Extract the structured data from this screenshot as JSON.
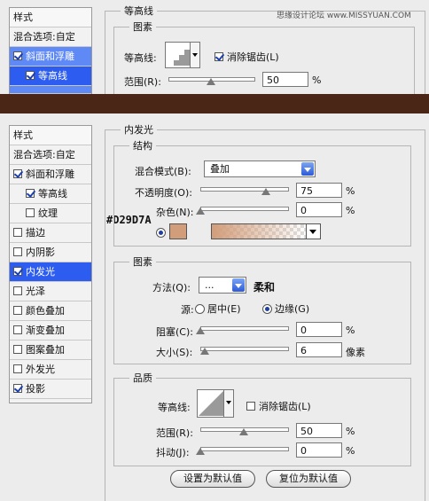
{
  "watermark": "思缘设计论坛 www.MISSYUAN.COM",
  "colors": {
    "swatch": "#D29D7A",
    "selected_row": "#2d5df0",
    "band": "#4a2616"
  },
  "color_annotation": "#D29D7A",
  "top_panel": {
    "sidebar": {
      "header": "样式",
      "blend_options": "混合选项:自定",
      "bevel": "斜面和浮雕",
      "contour": "等高线",
      "texture": "纹理"
    },
    "section_title": "等高线",
    "group_title": "图素",
    "contour_label": "等高线:",
    "antialias_label": "消除锯齿(L)",
    "range_label": "范围(R):",
    "range_value": "50",
    "range_unit": "%",
    "range_level": 0.5
  },
  "sidebar": {
    "header": "样式",
    "items": [
      {
        "label": "混合选项:自定",
        "checkbox": false
      },
      {
        "label": "斜面和浮雕",
        "checkbox": true,
        "checked": true
      },
      {
        "label": "等高线",
        "checkbox": true,
        "checked": true,
        "sub": true
      },
      {
        "label": "纹理",
        "checkbox": true,
        "checked": false,
        "sub": true
      },
      {
        "label": "描边",
        "checkbox": true,
        "checked": false
      },
      {
        "label": "内阴影",
        "checkbox": true,
        "checked": false
      },
      {
        "label": "内发光",
        "checkbox": true,
        "checked": true,
        "selected": true
      },
      {
        "label": "光泽",
        "checkbox": true,
        "checked": false
      },
      {
        "label": "颜色叠加",
        "checkbox": true,
        "checked": false
      },
      {
        "label": "渐变叠加",
        "checkbox": true,
        "checked": false
      },
      {
        "label": "图案叠加",
        "checkbox": true,
        "checked": false
      },
      {
        "label": "外发光",
        "checkbox": true,
        "checked": false
      },
      {
        "label": "投影",
        "checkbox": true,
        "checked": true
      }
    ]
  },
  "inner_glow": {
    "title": "内发光",
    "structure": {
      "title": "结构",
      "blend_mode_label": "混合模式(B):",
      "blend_mode_value": "叠加",
      "opacity_label": "不透明度(O):",
      "opacity_value": "75",
      "opacity_level": 0.75,
      "noise_label": "杂色(N):",
      "noise_value": "0",
      "noise_level": 0,
      "unit": "%"
    },
    "elements": {
      "title": "图素",
      "technique_label": "方法(Q):",
      "technique_value": "...",
      "technique_note": "柔和",
      "source_label": "源:",
      "source_center": "居中(E)",
      "source_edge": "边缘(G)",
      "choke_label": "阻塞(C):",
      "choke_value": "0",
      "choke_level": 0,
      "size_label": "大小(S):",
      "size_value": "6",
      "size_unit": "像素",
      "unit": "%"
    },
    "quality": {
      "title": "品质",
      "contour_label": "等高线:",
      "antialias_label": "消除锯齿(L)",
      "range_label": "范围(R):",
      "range_value": "50",
      "range_level": 0.5,
      "jitter_label": "抖动(J):",
      "jitter_value": "0",
      "jitter_level": 0,
      "unit": "%"
    },
    "buttons": {
      "make_default": "设置为默认值",
      "reset_default": "复位为默认值"
    }
  }
}
